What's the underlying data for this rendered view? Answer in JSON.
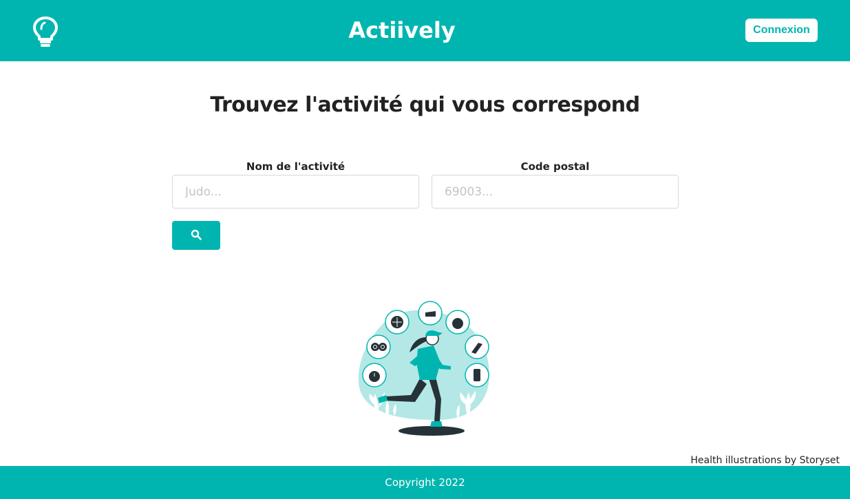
{
  "header": {
    "logo_icon": "lightbulb-icon",
    "title": "Actiively",
    "login_label": "Connexion"
  },
  "main": {
    "title": "Trouvez l'activité qui vous correspond",
    "activity_field": {
      "label": "Nom de l'activité",
      "placeholder": "Judo...",
      "value": ""
    },
    "postal_field": {
      "label": "Code postal",
      "placeholder": "69003...",
      "value": ""
    },
    "search_button_icon": "search-icon",
    "illustration": "running-woman-health-illustration"
  },
  "credit": "Health illustrations by Storyset",
  "footer": {
    "copyright": "Copyright 2022"
  },
  "colors": {
    "accent": "#00b5b0",
    "illustration_bg": "#b3e8e6",
    "dark": "#263238"
  }
}
